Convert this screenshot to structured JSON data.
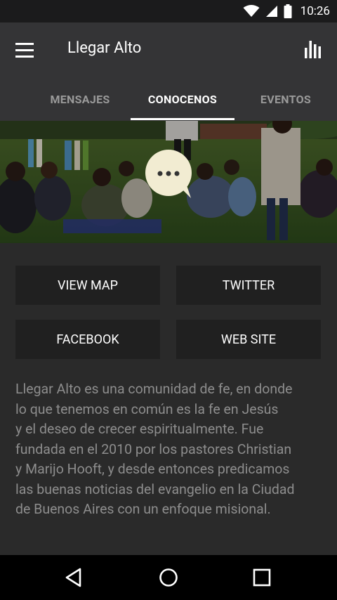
{
  "status_bar": {
    "time": "10:26"
  },
  "app_bar": {
    "title": "Llegar Alto"
  },
  "tabs": [
    {
      "label": "MENSAJES",
      "active": false
    },
    {
      "label": "CONOCENOS",
      "active": true
    },
    {
      "label": "EVENTOS",
      "active": false
    }
  ],
  "actions": {
    "view_map": "VIEW MAP",
    "twitter": "TWITTER",
    "facebook": "FACEBOOK",
    "web_site": "WEB SITE"
  },
  "description_lines": [
    "Llegar Alto es una comunidad de fe, en donde",
    "lo que tenemos en común es la fe en Jesús",
    "y el deseo de crecer espiritualmente. Fue",
    "fundada en el 2010 por los pastores Christian",
    "y Marijo Hooft, y desde entonces predicamos",
    "las buenas noticias del evangelio en la Ciudad",
    "de Buenos Aires con un enfoque misional."
  ],
  "colors": {
    "status_bar": "#1b1b1c",
    "app_bar": "#343436",
    "background": "#2a2a2a",
    "button": "#202020",
    "description_text": "#8d8d8d",
    "tab_inactive": "#9a9a9a",
    "bubble": "#f2ecd2"
  }
}
